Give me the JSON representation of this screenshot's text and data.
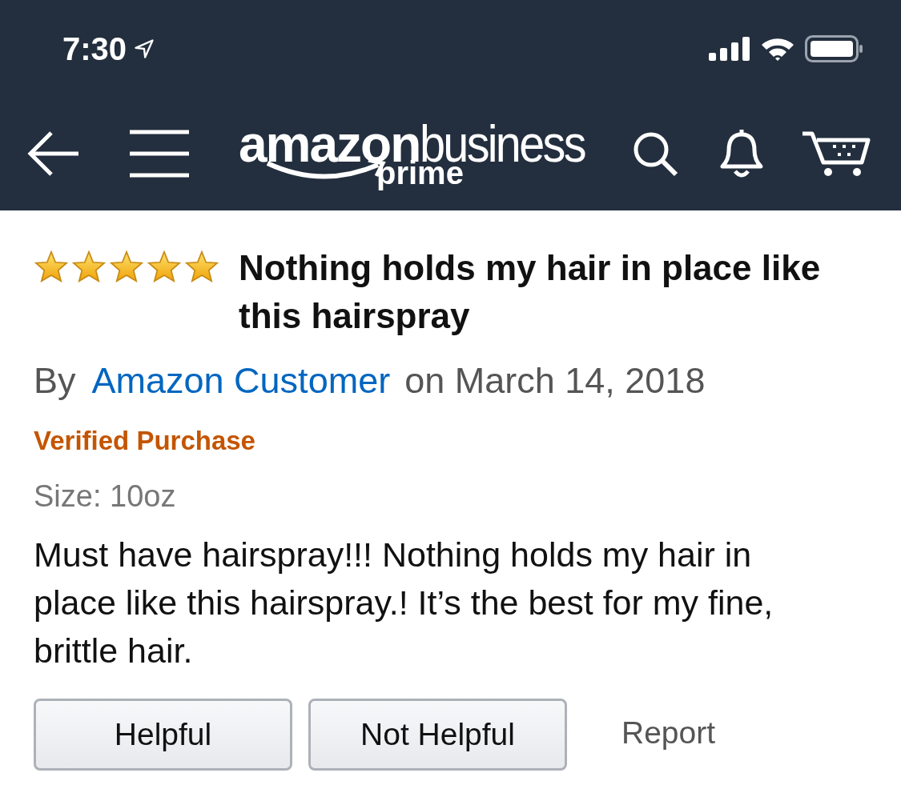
{
  "status_bar": {
    "time": "7:30"
  },
  "header": {
    "logo": {
      "word_1": "amazon",
      "word_2": "business",
      "word_3": "prime"
    }
  },
  "review": {
    "stars": 5,
    "title": "Nothing holds my hair in place like this hairspray",
    "by": "By",
    "author": "Amazon Customer",
    "date": "on March 14, 2018",
    "verified": "Verified Purchase",
    "size": "Size: 10oz",
    "body": "Must have hairspray!!! Nothing holds my hair in place like this hairspray.! It’s the best for my fine, brittle hair."
  },
  "actions": [
    {
      "kind": "button",
      "label": "Helpful"
    },
    {
      "kind": "button",
      "label": "Not Helpful"
    },
    {
      "kind": "link",
      "label": "Report"
    }
  ]
}
